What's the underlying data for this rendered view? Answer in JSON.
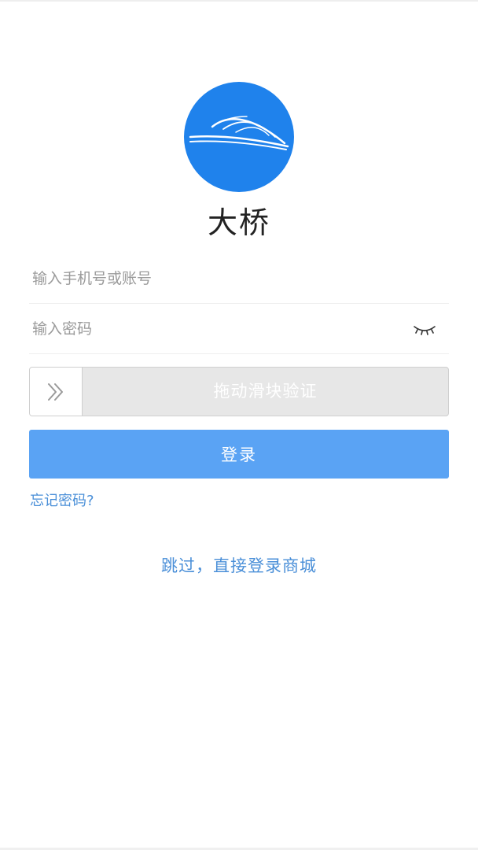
{
  "app": {
    "name": "大桥",
    "brand_color": "#1f82ec",
    "logo_icon": "bridge-arc-icon"
  },
  "login_form": {
    "account_placeholder": "输入手机号或账号",
    "password_placeholder": "输入密码",
    "password_toggle_icon": "closed-eye-icon",
    "slider": {
      "handle_icon": "double-chevron-right-icon",
      "label": "拖动滑块验证"
    },
    "login_label": "登录",
    "login_button_color": "#5aa3f4",
    "forgot_password_label": "忘记密码?",
    "link_color": "#4a8fd8"
  },
  "skip": {
    "label": "跳过，直接登录商城"
  }
}
